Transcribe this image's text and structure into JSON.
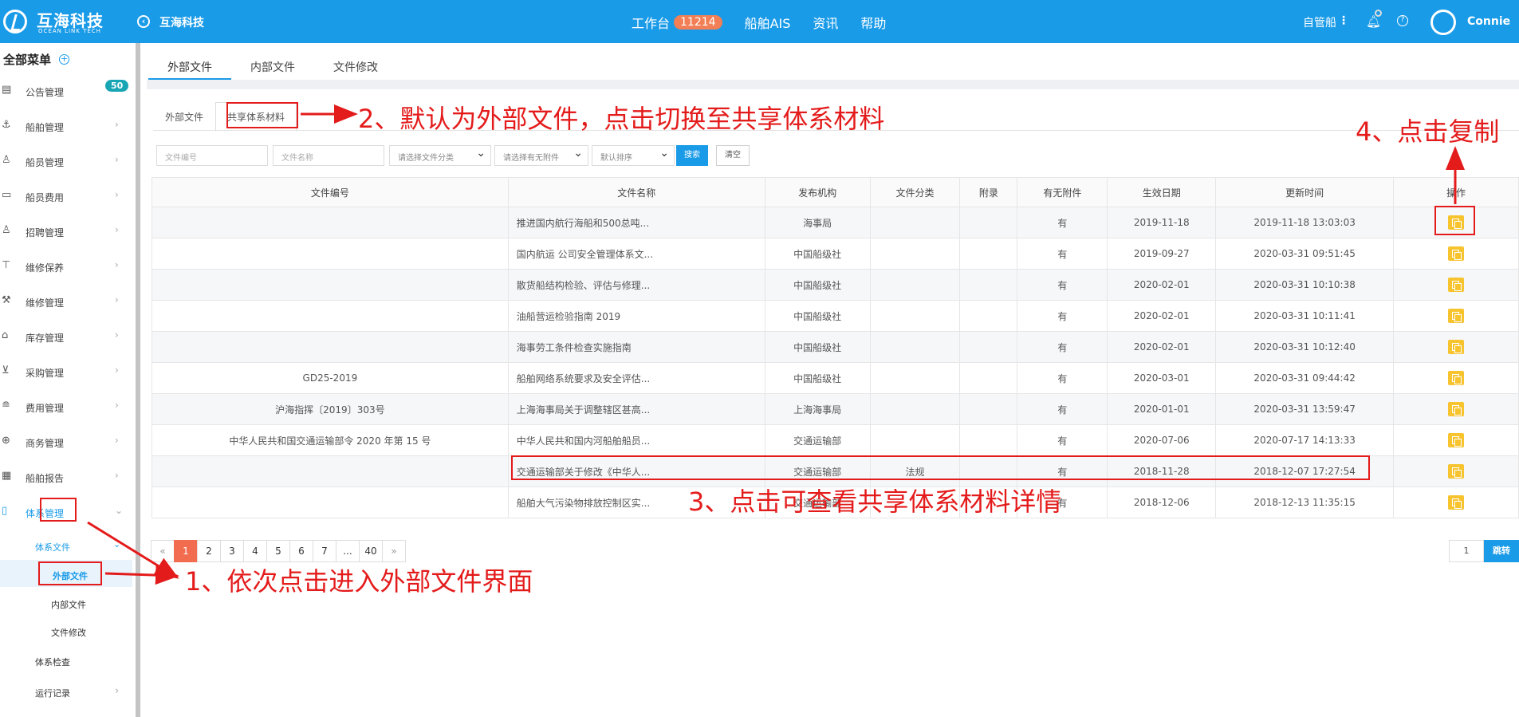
{
  "brand": {
    "name_cn": "互海科技",
    "name_en": "OCEAN LINK TECH",
    "title": "互海科技"
  },
  "nav": {
    "workbench": "工作台",
    "workbench_count": "11214",
    "ais": "船舶AIS",
    "news": "资讯",
    "help": "帮助"
  },
  "header": {
    "self_ship": "自管船",
    "user": "Connie"
  },
  "sidebar": {
    "title": "全部菜单",
    "badge": "50",
    "items": [
      {
        "label": "公告管理",
        "icon": "announcement-icon"
      },
      {
        "label": "船舶管理",
        "icon": "anchor-icon"
      },
      {
        "label": "船员管理",
        "icon": "user-icon"
      },
      {
        "label": "船员费用",
        "icon": "wallet-icon"
      },
      {
        "label": "招聘管理",
        "icon": "recruit-icon"
      },
      {
        "label": "维修保养",
        "icon": "tool-icon"
      },
      {
        "label": "维修管理",
        "icon": "wrench-icon"
      },
      {
        "label": "库存管理",
        "icon": "warehouse-icon"
      },
      {
        "label": "采购管理",
        "icon": "cart-icon"
      },
      {
        "label": "费用管理",
        "icon": "coins-icon"
      },
      {
        "label": "商务管理",
        "icon": "globe-icon"
      },
      {
        "label": "船舶报告",
        "icon": "calendar-icon"
      },
      {
        "label": "体系管理",
        "icon": "doc-icon"
      }
    ],
    "sub": {
      "system_files": "体系文件",
      "external": "外部文件",
      "internal": "内部文件",
      "revision": "文件修改",
      "check": "体系检查",
      "run_record": "运行记录"
    }
  },
  "tabs": [
    "外部文件",
    "内部文件",
    "文件修改"
  ],
  "inner_tabs": [
    "外部文件",
    "共享体系材料"
  ],
  "filters": {
    "file_no": "文件编号",
    "file_name": "文件名称",
    "category": "请选择文件分类",
    "attachment": "请选择有无附件",
    "sort": "默认排序",
    "search": "搜索",
    "clear": "清空"
  },
  "table": {
    "headers": [
      "文件编号",
      "文件名称",
      "发布机构",
      "文件分类",
      "附录",
      "有无附件",
      "生效日期",
      "更新时间",
      "操作"
    ],
    "rows": [
      [
        "",
        "推进国内航行海船和500总吨...",
        "海事局",
        "",
        "",
        "有",
        "2019-11-18",
        "2019-11-18 13:03:03"
      ],
      [
        "",
        "国内航运 公司安全管理体系文...",
        "中国船级社",
        "",
        "",
        "有",
        "2019-09-27",
        "2020-03-31 09:51:45"
      ],
      [
        "",
        "散货船结构检验、评估与修理...",
        "中国船级社",
        "",
        "",
        "有",
        "2020-02-01",
        "2020-03-31 10:10:38"
      ],
      [
        "",
        "油船营运检验指南 2019",
        "中国船级社",
        "",
        "",
        "有",
        "2020-02-01",
        "2020-03-31 10:11:41"
      ],
      [
        "",
        "海事劳工条件检查实施指南",
        "中国船级社",
        "",
        "",
        "有",
        "2020-02-01",
        "2020-03-31 10:12:40"
      ],
      [
        "GD25-2019",
        "船舶网络系统要求及安全评估...",
        "中国船级社",
        "",
        "",
        "有",
        "2020-03-01",
        "2020-03-31 09:44:42"
      ],
      [
        "沪海指挥〔2019〕303号",
        "上海海事局关于调整辖区甚高...",
        "上海海事局",
        "",
        "",
        "有",
        "2020-01-01",
        "2020-03-31 13:59:47"
      ],
      [
        "中华人民共和国交通运输部令 2020 年第 15 号",
        "中华人民共和国内河船舶船员...",
        "交通运输部",
        "",
        "",
        "有",
        "2020-07-06",
        "2020-07-17 14:13:33"
      ],
      [
        "",
        "交通运输部关于修改《中华人...",
        "交通运输部",
        "法规",
        "",
        "有",
        "2018-11-28",
        "2018-12-07 17:27:54"
      ],
      [
        "",
        "船舶大气污染物排放控制区实...",
        "交通运输部",
        "",
        "",
        "有",
        "2018-12-06",
        "2018-12-13 11:35:15"
      ]
    ]
  },
  "pagination": {
    "prev": "«",
    "pages": [
      "1",
      "2",
      "3",
      "4",
      "5",
      "6",
      "7",
      "...",
      "40"
    ],
    "next": "»",
    "jump_value": "1",
    "jump": "跳转"
  },
  "annotations": {
    "a1": "1、依次点击进入外部文件界面",
    "a2": "2、默认为外部文件，点击切换至共享体系材料",
    "a3": "3、点击可查看共享体系材料详情",
    "a4": "4、点击复制"
  },
  "colors": {
    "primary": "#1a9be8",
    "annotation": "#e41b1b",
    "current_page": "#f26c4f",
    "copy": "#f7c42f",
    "count_badge": "#f27f55",
    "menu_badge": "#18a6b5"
  }
}
